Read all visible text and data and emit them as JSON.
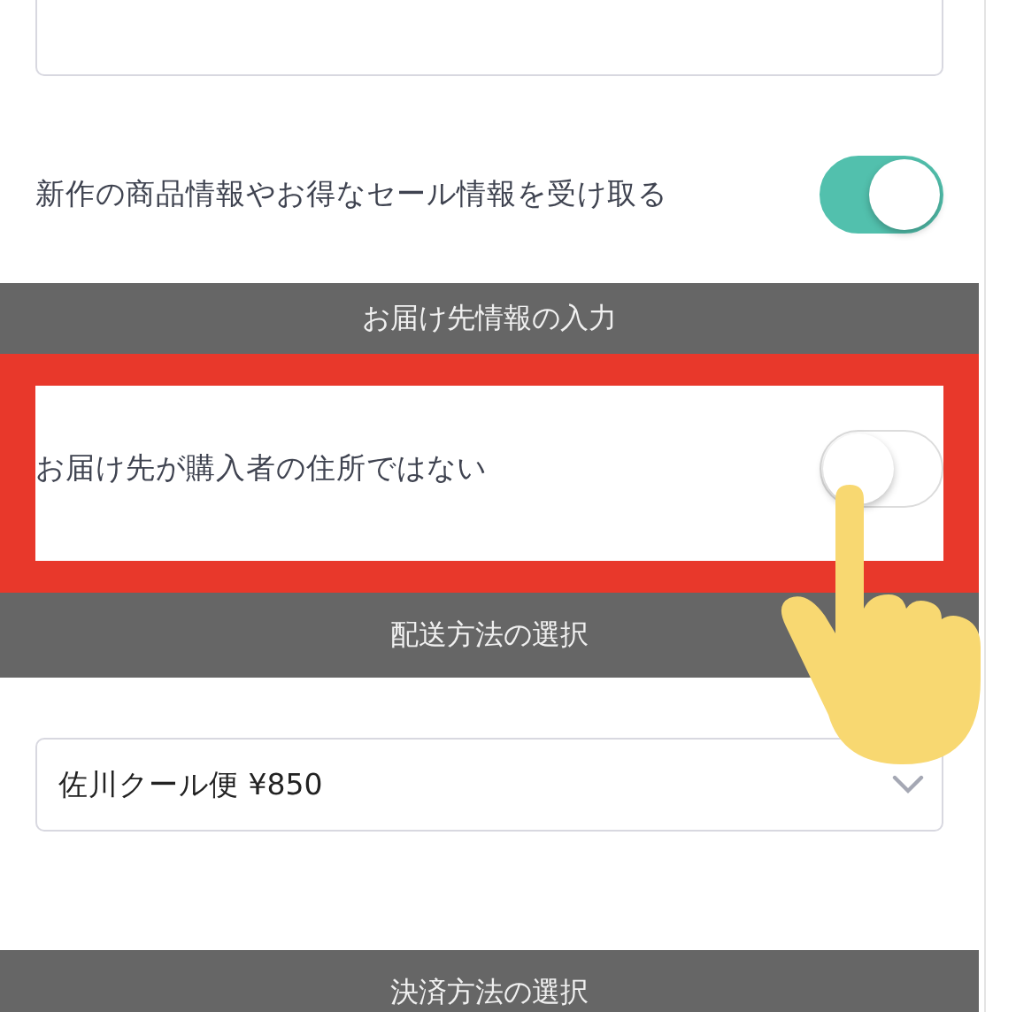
{
  "top_field": {
    "kind": "textarea"
  },
  "newsletter": {
    "label": "新作の商品情報やお得なセール情報を受け取る",
    "on": true
  },
  "sections": [
    {
      "title": "お届け先情報の入力",
      "rows": [
        {
          "kind": "toggle",
          "label": "お届け先が購入者の住所ではない",
          "on": false,
          "highlighted": true
        }
      ]
    },
    {
      "title": "配送方法の選択",
      "rows": [
        {
          "kind": "select",
          "value": "佐川クール便 ¥850",
          "highlighted": false
        }
      ]
    },
    {
      "title": "決済方法の選択"
    }
  ]
}
